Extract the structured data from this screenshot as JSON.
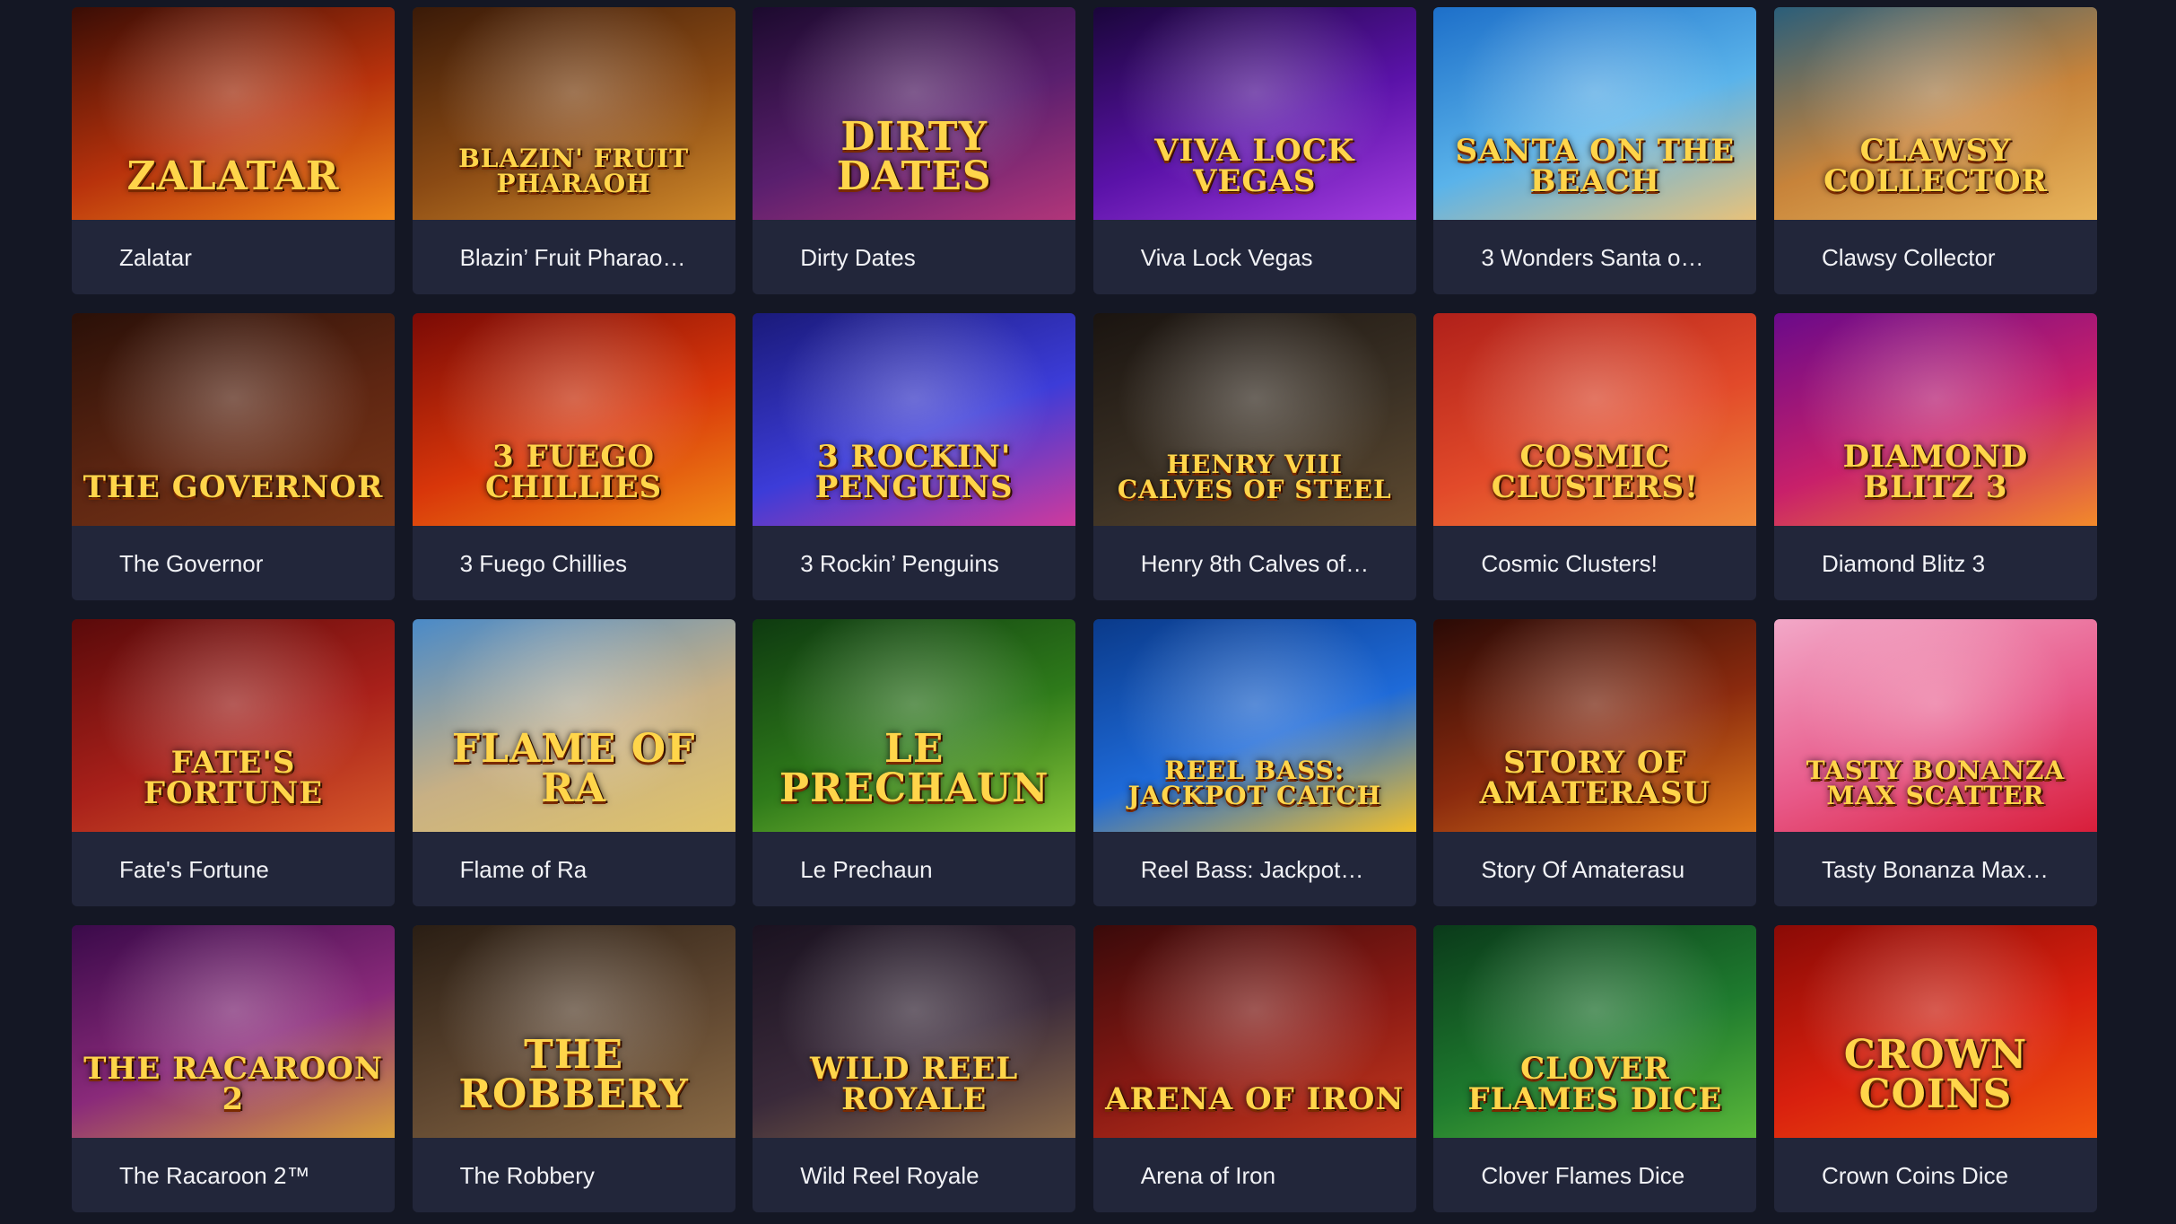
{
  "games": [
    {
      "title": "Zalatar",
      "logo": "ZALATAR",
      "colors": [
        "#3a0d05",
        "#b8320c",
        "#f28a1a"
      ]
    },
    {
      "title": "Blazin’ Fruit Pharao…",
      "logo": "BLAZIN' FRUIT PHARAOH",
      "colors": [
        "#3a1a08",
        "#8a4a14",
        "#d08a2a"
      ]
    },
    {
      "title": "Dirty Dates",
      "logo": "DIRTY DATES",
      "colors": [
        "#1c0a2e",
        "#5a1f6e",
        "#b2367a"
      ]
    },
    {
      "title": "Viva Lock Vegas",
      "logo": "VIVA LOCK VEGAS",
      "colors": [
        "#1a063a",
        "#5a12a8",
        "#a53de0"
      ]
    },
    {
      "title": "3 Wonders Santa o…",
      "logo": "SANTA ON THE BEACH",
      "colors": [
        "#1d6fc9",
        "#5ab3ea",
        "#e8c27a"
      ]
    },
    {
      "title": "Clawsy Collector",
      "logo": "CLAWSY COLLECTOR",
      "colors": [
        "#2a5e7a",
        "#c7833a",
        "#e8b45a"
      ]
    },
    {
      "title": "The Governor",
      "logo": "THE GOVERNOR",
      "colors": [
        "#2a1008",
        "#5e2612",
        "#7a3818"
      ]
    },
    {
      "title": "3 Fuego Chillies",
      "logo": "3 FUEGO CHILLIES",
      "colors": [
        "#7a0a06",
        "#d8360a",
        "#f28c16"
      ]
    },
    {
      "title": "3 Rockin’ Penguins",
      "logo": "3 ROCKIN' PENGUINS",
      "colors": [
        "#1a1a7a",
        "#3c3cd8",
        "#d03a9c"
      ]
    },
    {
      "title": "Henry 8th Calves of…",
      "logo": "HENRY VIII CALVES OF STEEL",
      "colors": [
        "#1a1410",
        "#3a3024",
        "#5e4a30"
      ]
    },
    {
      "title": "Cosmic Clusters!",
      "logo": "COSMIC CLUSTERS!",
      "colors": [
        "#b0201a",
        "#e24a2a",
        "#f08a3a"
      ]
    },
    {
      "title": "Diamond Blitz 3",
      "logo": "DIAMOND BLITZ 3",
      "colors": [
        "#6a0a8a",
        "#c8206a",
        "#f28a2a"
      ]
    },
    {
      "title": "Fate's Fortune",
      "logo": "FATE'S FORTUNE",
      "colors": [
        "#5a0a0a",
        "#a8201a",
        "#d85a2a"
      ]
    },
    {
      "title": "Flame of Ra",
      "logo": "FLAME OF RA",
      "colors": [
        "#4a8ac8",
        "#c8b084",
        "#e0c46a"
      ]
    },
    {
      "title": "Le Prechaun",
      "logo": "LE PRECHAUN",
      "colors": [
        "#0e3a10",
        "#2e7a1a",
        "#8ac83a"
      ]
    },
    {
      "title": "Reel Bass: Jackpot…",
      "logo": "REEL BASS: JACKPOT CATCH",
      "colors": [
        "#0a3a8a",
        "#1e6ad8",
        "#f2c02a"
      ]
    },
    {
      "title": "Story Of Amaterasu",
      "logo": "STORY OF AMATERASU",
      "colors": [
        "#2a0a06",
        "#8a2a0e",
        "#e07a1a"
      ]
    },
    {
      "title": "Tasty Bonanza Max…",
      "logo": "TASTY BONANZA MAX SCATTER",
      "colors": [
        "#f2a8c8",
        "#e85a8a",
        "#d81e3a"
      ]
    },
    {
      "title": "The Racaroon 2™",
      "logo": "THE RACAROON 2",
      "colors": [
        "#3a0a4a",
        "#8a2a7a",
        "#d8a03a"
      ]
    },
    {
      "title": "The Robbery",
      "logo": "THE ROBBERY",
      "colors": [
        "#2a1e14",
        "#5e4630",
        "#8a6a44"
      ]
    },
    {
      "title": "Wild Reel Royale",
      "logo": "WILD REEL ROYALE",
      "colors": [
        "#1a1220",
        "#3a2a3a",
        "#8a6a4a"
      ]
    },
    {
      "title": "Arena of Iron",
      "logo": "ARENA OF IRON",
      "colors": [
        "#3a0a0a",
        "#8a1a14",
        "#c83a1e"
      ]
    },
    {
      "title": "Clover Flames Dice",
      "logo": "CLOVER FLAMES DICE",
      "colors": [
        "#0a3a1a",
        "#1e7a2e",
        "#5ab83a"
      ]
    },
    {
      "title": "Crown Coins Dice",
      "logo": "CROWN COINS",
      "colors": [
        "#8a0a06",
        "#d8200e",
        "#f2560e"
      ]
    }
  ]
}
